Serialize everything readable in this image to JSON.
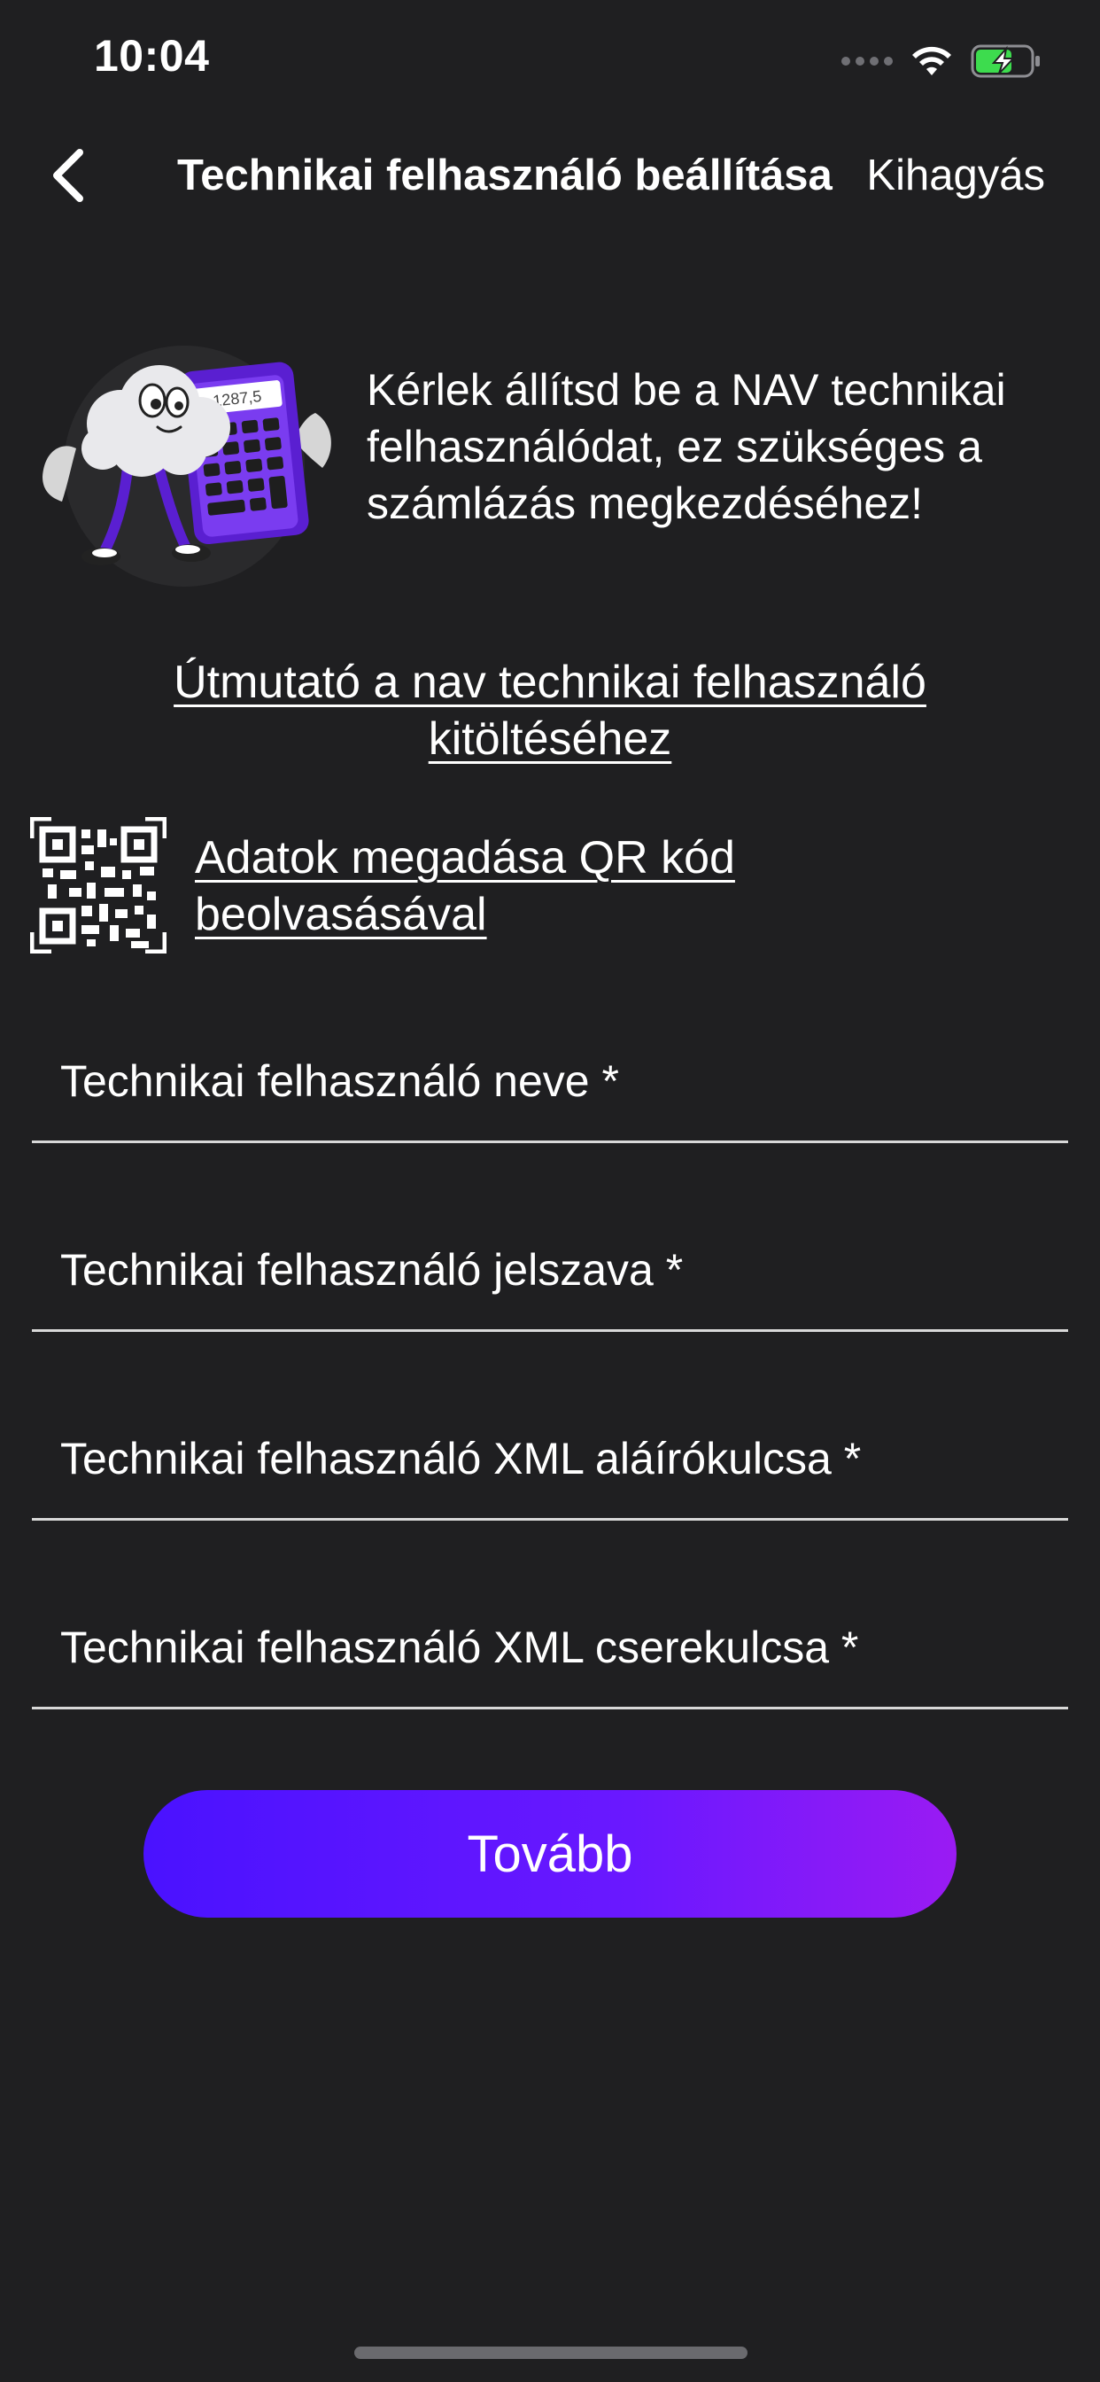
{
  "status_bar": {
    "time": "10:04"
  },
  "nav": {
    "title": "Technikai felhasználó beállítása",
    "skip_label": "Kihagyás"
  },
  "intro": {
    "text": "Kérlek állítsd be a NAV technikai felhasználódat, ez szükséges a számlázás megkezdéséhez!",
    "calculator_display": "1287,5"
  },
  "links": {
    "guide": "Útmutató a nav technikai felhasználó kitöltéséhez",
    "qr": "Adatok megadása QR kód beolvasásával"
  },
  "form": {
    "fields": [
      {
        "label": "Technikai felhasználó neve *",
        "value": ""
      },
      {
        "label": "Technikai felhasználó jelszava *",
        "value": ""
      },
      {
        "label": "Technikai felhasználó XML aláírókulcsa *",
        "value": ""
      },
      {
        "label": "Technikai felhasználó XML cserekulcsa *",
        "value": ""
      }
    ],
    "submit_label": "Tovább"
  },
  "colors": {
    "background": "#1f1f21",
    "button_gradient_start": "#4a12ff",
    "button_gradient_end": "#9a1bf3",
    "battery_green": "#3ddc4e"
  },
  "battery": {
    "charging": true
  }
}
